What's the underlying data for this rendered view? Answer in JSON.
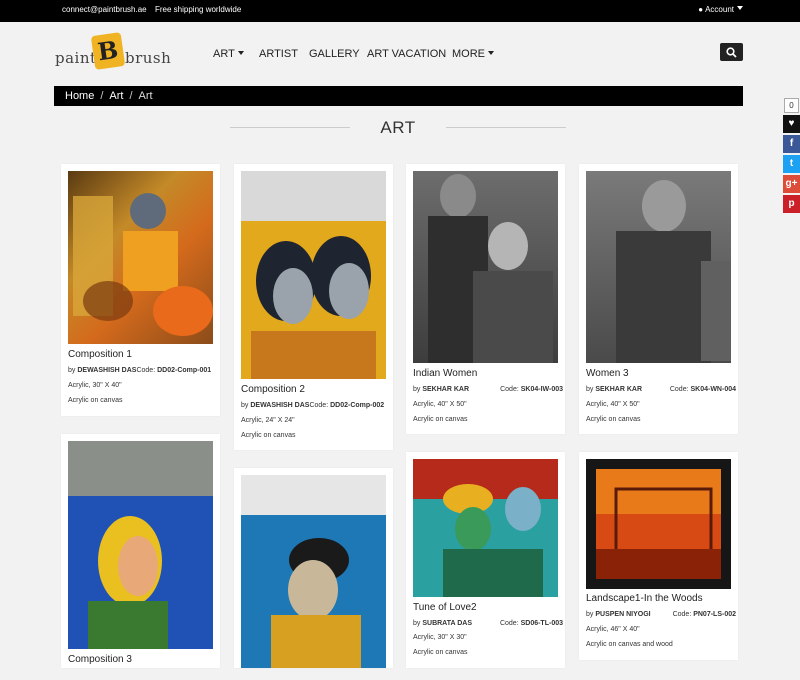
{
  "topbar": {
    "email": "connect@paintbrush.ae",
    "shipping": "Free shipping worldwide",
    "account": "Account"
  },
  "logo": {
    "left": "paint",
    "badge": "B",
    "right": "brush"
  },
  "nav": {
    "art": "ART",
    "artist": "ARTIST",
    "gallery": "GALLERY",
    "vacation": "ART VACATION",
    "more": "MORE"
  },
  "breadcrumb": {
    "home": "Home",
    "mid": "Art",
    "current": "Art",
    "sep": "/"
  },
  "heading": "ART",
  "social": {
    "count": "0",
    "heart": "♥",
    "facebook": "f",
    "twitter": "t",
    "google": "g+",
    "pinterest": "p"
  },
  "products": [
    {
      "title": "Composition 1",
      "by": "by ",
      "artist": "DEWASHISH DAS",
      "code_label": "Code: ",
      "code": "DD02-Comp-001",
      "size": "Acrylic, 30\" X 40\"",
      "medium": "Acrylic on canvas"
    },
    {
      "title": "Composition 2",
      "by": "by ",
      "artist": "DEWASHISH DAS",
      "code_label": "Code: ",
      "code": "DD02-Comp-002",
      "size": "Acrylic, 24\" X 24\"",
      "medium": "Acrylic on canvas"
    },
    {
      "title": "Indian Women",
      "by": "by ",
      "artist": "SEKHAR KAR",
      "code_label": "Code: ",
      "code": "SK04-IW-003",
      "size": "Acrylic, 40\" X 50\"",
      "medium": "Acrylic on canvas"
    },
    {
      "title": "Women 3",
      "by": "by ",
      "artist": "SEKHAR KAR",
      "code_label": "Code: ",
      "code": "SK04-WN-004",
      "size": "Acrylic, 40\" X 50\"",
      "medium": "Acrylic on canvas"
    },
    {
      "title": "Composition 3"
    },
    {
      "title": ""
    },
    {
      "title": "Tune of Love2",
      "by": "by ",
      "artist": "SUBRATA DAS",
      "code_label": "Code: ",
      "code": "SD06-TL-003",
      "size": "Acrylic, 30\" X 30\"",
      "medium": "Acrylic on canvas"
    },
    {
      "title": "Landscape1-In the Woods",
      "by": "by ",
      "artist": "PUSPEN NIYOGI",
      "code_label": "Code: ",
      "code": "PN07-LS-002",
      "size": "Acrylic, 46\" X 40\"",
      "medium": "Acrylic on canvas and wood"
    }
  ]
}
